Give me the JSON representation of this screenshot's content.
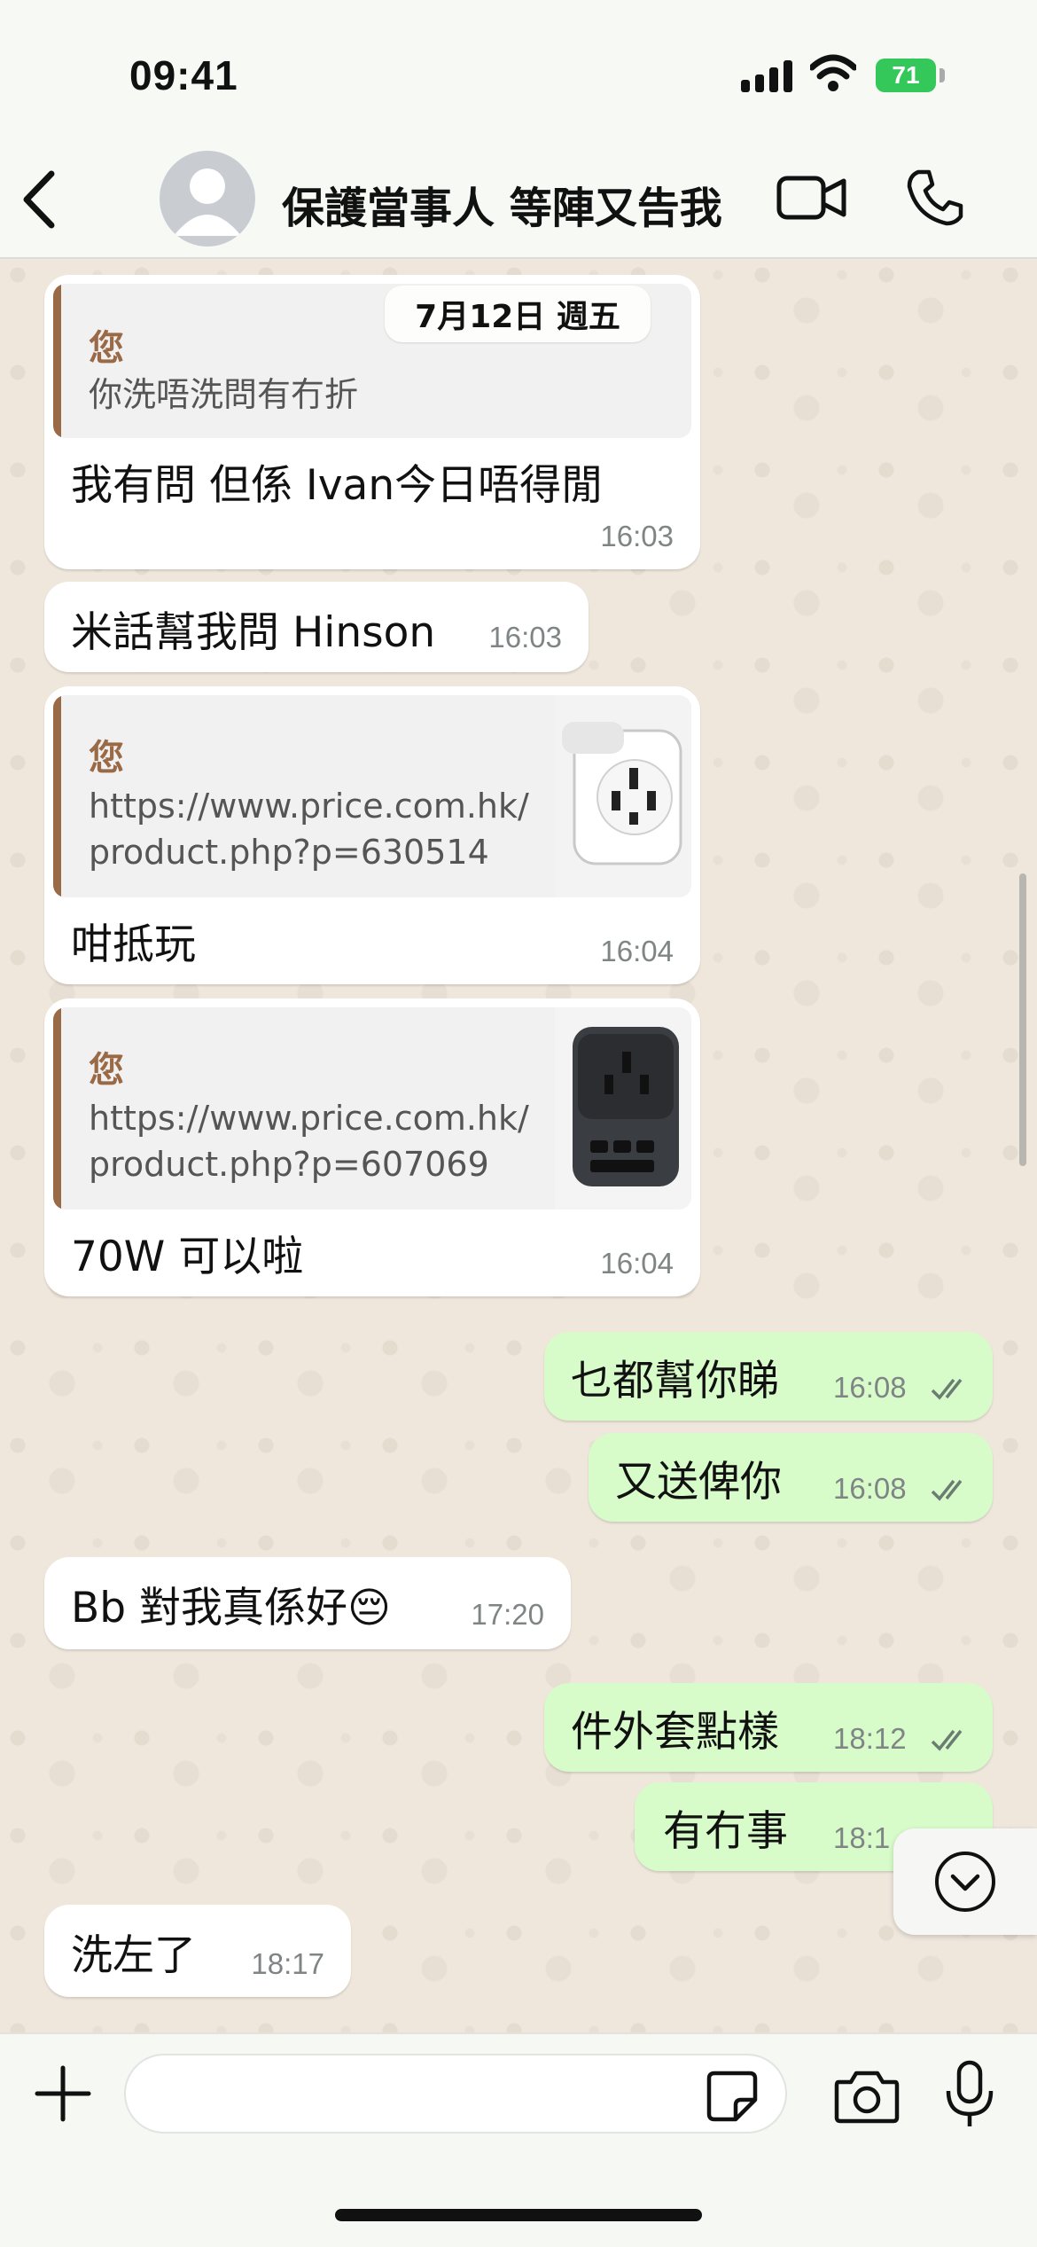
{
  "status_bar": {
    "time": "09:41",
    "battery": "71"
  },
  "header": {
    "title": "保護當事人 等陣又告我"
  },
  "date_separator": "7月12日 週五",
  "messages": [
    {
      "quote_author": "您",
      "quote_text": "你洗唔洗問有冇折",
      "text": "我有問 但係 Ivan今日唔得閒",
      "time": "16:03"
    },
    {
      "text": "米話幫我問 Hinson",
      "time": "16:03"
    },
    {
      "quote_author": "您",
      "quote_line1": "https://www.price.com.hk/",
      "quote_line2": "product.php?p=630514",
      "text": "咁抵玩",
      "time": "16:04"
    },
    {
      "quote_author": "您",
      "quote_line1": "https://www.price.com.hk/",
      "quote_line2": "product.php?p=607069",
      "text": "70W 可以啦",
      "time": "16:04"
    },
    {
      "text": "乜都幫你睇",
      "time": "16:08"
    },
    {
      "text": "又送俾你",
      "time": "16:08"
    },
    {
      "text": "Bb 對我真係好",
      "emoji": "😔",
      "time": "17:20"
    },
    {
      "text": "件外套點樣",
      "time": "18:12"
    },
    {
      "text": "有冇事",
      "time": "18:1"
    },
    {
      "text": "洗左了",
      "time": "18:17"
    }
  ],
  "colors": {
    "incoming": "#ffffff",
    "outgoing": "#d7fbc9",
    "quote_accent": "#9a6a46",
    "battery": "#34c759",
    "read_ticks": "#6b7d72"
  },
  "icons": [
    "back-arrow-icon",
    "avatar-icon",
    "video-call-icon",
    "phone-icon",
    "plus-icon",
    "sticker-icon",
    "camera-icon",
    "mic-icon",
    "chevron-down-icon",
    "double-check-icon"
  ]
}
